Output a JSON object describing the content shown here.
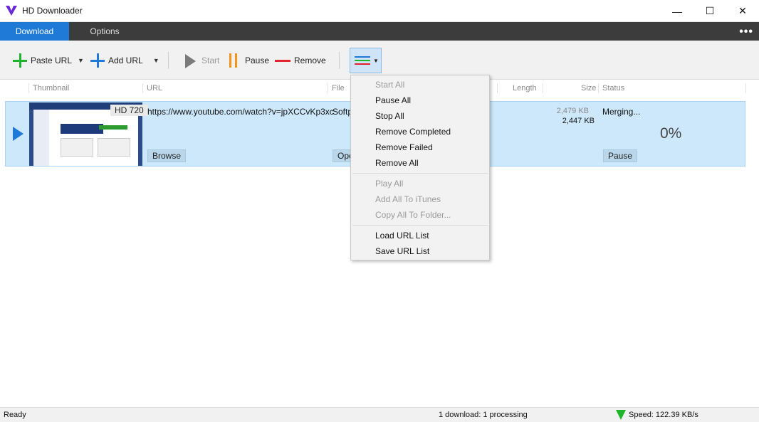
{
  "window": {
    "title": "HD Downloader",
    "controls": {
      "minimize": "—",
      "maximize": "☐",
      "close": "✕"
    }
  },
  "tabs": [
    {
      "label": "Download",
      "active": true
    },
    {
      "label": "Options",
      "active": false
    }
  ],
  "more_menu": "•••",
  "toolbar": {
    "paste_url": "Paste URL",
    "add_url": "Add URL",
    "start": "Start",
    "pause": "Pause",
    "remove": "Remove"
  },
  "columns": [
    "Thumbnail",
    "URL",
    "File",
    "Length",
    "Size",
    "Status"
  ],
  "download": {
    "quality": "HD 720",
    "url": "https://www.youtube.com/watch?v=jpXCCvKp3xc",
    "file": "Softpedia",
    "size_total": "2,479 KB",
    "size_done": "2,447 KB",
    "status": "Merging...",
    "progress_text": "0%",
    "browse_label": "Browse",
    "open_label": "Open",
    "pause_label": "Pause"
  },
  "dropdown": {
    "items": [
      {
        "label": "Start All",
        "enabled": false
      },
      {
        "label": "Pause All",
        "enabled": true
      },
      {
        "label": "Stop All",
        "enabled": true
      },
      {
        "label": "Remove Completed",
        "enabled": true
      },
      {
        "label": "Remove Failed",
        "enabled": true
      },
      {
        "label": "Remove All",
        "enabled": true
      },
      {
        "label": "Play All",
        "enabled": false
      },
      {
        "label": "Add All To iTunes",
        "enabled": false
      },
      {
        "label": "Copy All To Folder...",
        "enabled": false
      },
      {
        "label": "Load URL List",
        "enabled": true
      },
      {
        "label": "Save URL List",
        "enabled": true
      }
    ]
  },
  "statusbar": {
    "state": "Ready",
    "count": "1 download: 1 processing",
    "speed": "Speed: 122.39 KB/s"
  },
  "colors": {
    "accent": "#1e7ad6",
    "row_selected": "#cde8fb",
    "tabbar": "#3c3c3c",
    "add_green": "#1fb52b",
    "pause_orange": "#f4941c",
    "remove_red": "#e0242b"
  }
}
